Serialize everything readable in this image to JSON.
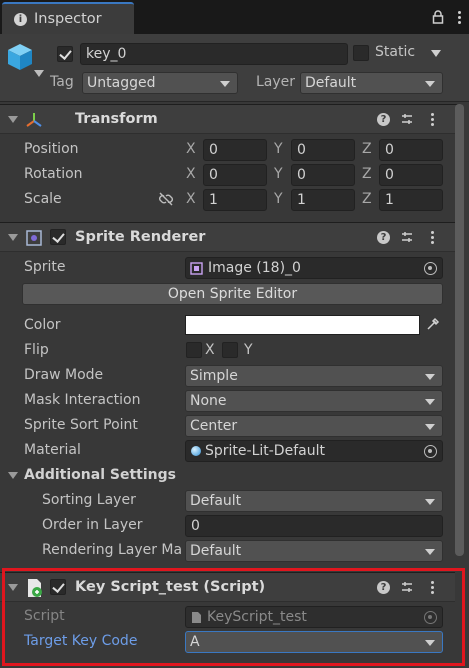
{
  "tab": {
    "title": "Inspector"
  },
  "header": {
    "object_name": "key_0",
    "static_label": "Static",
    "tag_label": "Tag",
    "tag_value": "Untagged",
    "layer_label": "Layer",
    "layer_value": "Default"
  },
  "transform": {
    "title": "Transform",
    "position_label": "Position",
    "rotation_label": "Rotation",
    "scale_label": "Scale",
    "axis_x": "X",
    "axis_y": "Y",
    "axis_z": "Z",
    "position": {
      "x": "0",
      "y": "0",
      "z": "0"
    },
    "rotation": {
      "x": "0",
      "y": "0",
      "z": "0"
    },
    "scale": {
      "x": "1",
      "y": "1",
      "z": "1"
    }
  },
  "sprite_renderer": {
    "title": "Sprite Renderer",
    "sprite_label": "Sprite",
    "sprite_value": "Image (18)_0",
    "open_editor_label": "Open Sprite Editor",
    "color_label": "Color",
    "color_value": "#ffffff",
    "flip_label": "Flip",
    "flip_x": "X",
    "flip_y": "Y",
    "draw_mode_label": "Draw Mode",
    "draw_mode_value": "Simple",
    "mask_label": "Mask Interaction",
    "mask_value": "None",
    "sort_point_label": "Sprite Sort Point",
    "sort_point_value": "Center",
    "material_label": "Material",
    "material_value": "Sprite-Lit-Default",
    "additional_label": "Additional Settings",
    "sorting_layer_label": "Sorting Layer",
    "sorting_layer_value": "Default",
    "order_label": "Order in Layer",
    "order_value": "0",
    "rendering_layer_label": "Rendering Layer Ma",
    "rendering_layer_value": "Default"
  },
  "key_script": {
    "title": "Key Script_test (Script)",
    "script_label": "Script",
    "script_value": "KeyScript_test",
    "target_label": "Target Key Code",
    "target_value": "A",
    "highlight_color": "#e0161e"
  },
  "colors": {
    "accent": "#3a78c2",
    "link_label": "#6d9de8"
  }
}
